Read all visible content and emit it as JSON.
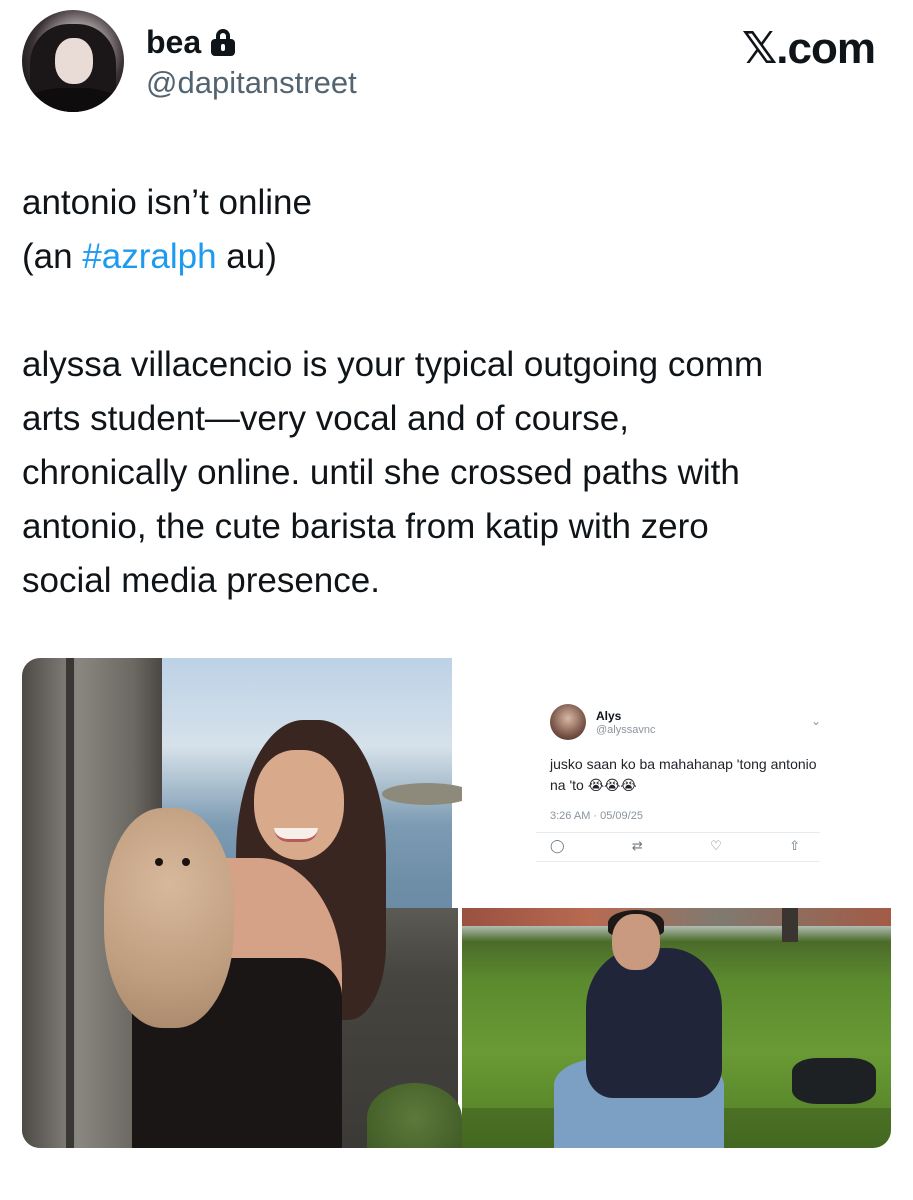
{
  "author": {
    "display_name": "bea",
    "handle": "@dapitanstreet",
    "protected_icon": "lock-icon"
  },
  "brand": "𝕏.com",
  "tweet": {
    "line1": "antonio isn’t online",
    "line2_prefix": "(an ",
    "line2_hashtag": "#azralph",
    "line2_suffix": " au)",
    "paragraph": "alyssa villacencio is your typical outgoing comm\narts student—very vocal and of course,\nchronically online. until she crossed paths with\nantonio, the cute barista from katip with zero\nsocial media presence."
  },
  "colors": {
    "hashtag": "#1d9bf0",
    "text": "#0f1419",
    "secondary": "#536471"
  },
  "embedded_tweet": {
    "name": "Alys",
    "handle": "@alyssavnc",
    "body": "jusko saan ko ba mahahanap 'tong antonio na 'to 😭😭😭",
    "time": "3:26 AM · 05/09/25",
    "actions": [
      "reply-icon",
      "retweet-icon",
      "like-icon",
      "share-icon"
    ]
  },
  "media": {
    "left_photo": "woman-with-dog-photo",
    "right_photo": "man-on-grass-photo"
  }
}
